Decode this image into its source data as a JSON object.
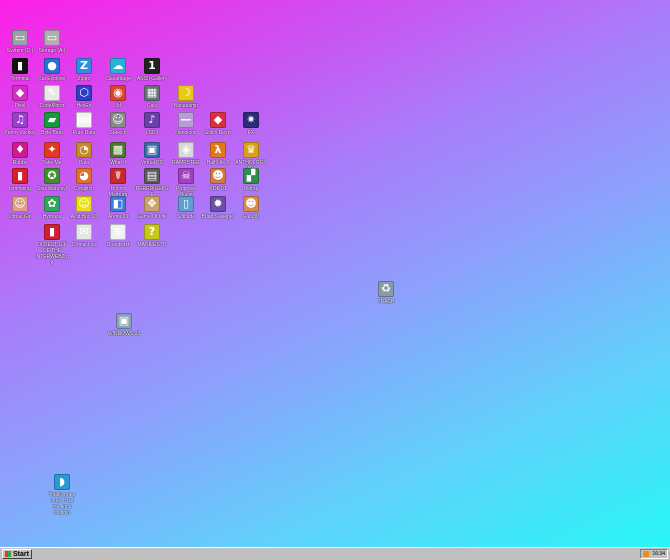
{
  "desktop": {
    "icons": [
      {
        "label": "System (C:)",
        "glyph": "▭",
        "color": "#9aa0a6",
        "name": "system-c-drive"
      },
      {
        "label": "Storage (A:)",
        "glyph": "▭",
        "color": "#b0b0b0",
        "name": "storage-a-drive"
      },
      {
        "label": "Terminal",
        "glyph": "▮",
        "color": "#111111",
        "name": "terminal"
      },
      {
        "label": "Cat Explorer",
        "glyph": "●",
        "color": "#2a6fd6",
        "name": "cat-explorer"
      },
      {
        "label": "Zippo",
        "glyph": "Z",
        "color": "#2f8de4",
        "name": "zippo"
      },
      {
        "label": "Clavardage",
        "glyph": "☁",
        "color": "#27b3d9",
        "name": "clavardage"
      },
      {
        "label": "ASCII Gallery",
        "glyph": "1",
        "color": "#222222",
        "name": "ascii-gallery"
      },
      {
        "label": "Pixel",
        "glyph": "◆",
        "color": "#d52cc4",
        "name": "pixel"
      },
      {
        "label": "CodeMirror",
        "glyph": "✎",
        "color": "#e8e8e8",
        "name": "codemirror"
      },
      {
        "label": "HexEd",
        "glyph": "⬡",
        "color": "#2e3cc9",
        "name": "hexed"
      },
      {
        "label": "3d",
        "glyph": "◉",
        "color": "#d9462f",
        "name": "3d"
      },
      {
        "label": "Calc",
        "glyph": "▦",
        "color": "#6a6f7a",
        "name": "calc"
      },
      {
        "label": "Bananamp",
        "glyph": "☽",
        "color": "#e8c91a",
        "name": "bananamp"
      },
      {
        "label": "Penny Jockey",
        "glyph": "♫",
        "color": "#9a3fcc",
        "name": "penny-jockey"
      },
      {
        "label": "Byte Beat",
        "glyph": "▰",
        "color": "#169a3a",
        "name": "byte-beat"
      },
      {
        "label": "Pure Data",
        "glyph": "pd",
        "color": "#f2f2f2",
        "name": "pure-data"
      },
      {
        "label": "Speech",
        "glyph": "☺",
        "color": "#8a8a8a",
        "name": "speech"
      },
      {
        "label": "LSDJ",
        "glyph": "♪",
        "color": "#6b3fa8",
        "name": "lsdj"
      },
      {
        "label": "Nanoloop",
        "glyph": "—",
        "color": "#b99bd8",
        "name": "nanoloop"
      },
      {
        "label": "Glitch Devts",
        "glyph": "◆",
        "color": "#d92f3f",
        "name": "glitch-devts"
      },
      {
        "label": "FX",
        "glyph": "✷",
        "color": "#2b2b7a",
        "name": "fx"
      },
      {
        "label": "Rubby",
        "glyph": "♦",
        "color": "#d01b8e",
        "name": "rubby"
      },
      {
        "label": "Take Me",
        "glyph": "✦",
        "color": "#e33a1f",
        "name": "take-me"
      },
      {
        "label": "Pata",
        "glyph": "◔",
        "color": "#c7882a",
        "name": "pata"
      },
      {
        "label": "What If",
        "glyph": "▩",
        "color": "#4b7a2a",
        "name": "what-if"
      },
      {
        "label": "Virtual PC",
        "glyph": "▣",
        "color": "#3b6ea8",
        "name": "virtual-pc"
      },
      {
        "label": "RAMPSTER",
        "glyph": "◈",
        "color": "#d9d9d9",
        "name": "rampster"
      },
      {
        "label": "Half-Life 3",
        "glyph": "λ",
        "color": "#e37a1a",
        "name": "half-life-3"
      },
      {
        "label": "ANTHOLOGY AVI",
        "glyph": "♛",
        "color": "#d6a21a",
        "name": "anthology-avi"
      },
      {
        "label": "lemmping",
        "glyph": "▮",
        "color": "#d81f2a",
        "name": "lemmping"
      },
      {
        "label": "Star Wars.avi",
        "glyph": "✪",
        "color": "#3f8f2f",
        "name": "star-wars-avi"
      },
      {
        "label": "Corglitch",
        "glyph": "◕",
        "color": "#e0702a",
        "name": "corglitch"
      },
      {
        "label": "Doctor Marburg",
        "glyph": "☤",
        "color": "#c82a2a",
        "name": "doctor-marburg"
      },
      {
        "label": "DEREDIGEKS E",
        "glyph": "▤",
        "color": "#5a5a5a",
        "name": "deredigekse"
      },
      {
        "label": "Progress Quest",
        "glyph": "☠",
        "color": "#a33fc2",
        "name": "progress-quest"
      },
      {
        "label": "KOF 91",
        "glyph": "☻",
        "color": "#d27a3f",
        "name": "kof-91"
      },
      {
        "label": "Defrag",
        "glyph": "▞",
        "color": "#2f8f4f",
        "name": "defrag"
      },
      {
        "label": "Virtual Girl",
        "glyph": "☺",
        "color": "#d9a08a",
        "name": "virtual-girl"
      },
      {
        "label": "Hydraze",
        "glyph": "✿",
        "color": "#2fa85a",
        "name": "hydraze"
      },
      {
        "label": "Acid Box 93",
        "glyph": "☺",
        "color": "#e8e01a",
        "name": "acid-box-93"
      },
      {
        "label": "Arena 93",
        "glyph": "◧",
        "color": "#3f7ad9",
        "name": "arena-93"
      },
      {
        "label": "Game Of Life",
        "glyph": "✥",
        "color": "#c9a36a",
        "name": "game-of-life"
      },
      {
        "label": "Solitude",
        "glyph": "▯",
        "color": "#5f9ed1",
        "name": "solitude"
      },
      {
        "label": "Brian Sweeper",
        "glyph": "✹",
        "color": "#6a4fa8",
        "name": "brian-sweeper"
      },
      {
        "label": "Gafa3D",
        "glyph": "☻",
        "color": "#d98a4f",
        "name": "gafa3d"
      },
      {
        "label": "OLDEST GIF OF THE INTERWEBZ.gif",
        "glyph": "▮",
        "color": "#d11f2f",
        "name": "oldest-gif"
      },
      {
        "label": "Contact us",
        "glyph": "✉",
        "color": "#e6e6e6",
        "name": "contact-us"
      },
      {
        "label": "Credits.txt",
        "glyph": "≡",
        "color": "#f0f0f0",
        "name": "credits-txt"
      },
      {
        "label": "MANIFESTO",
        "glyph": "?",
        "color": "#c8c81a",
        "name": "manifesto"
      }
    ],
    "trash": {
      "label": "TRASH",
      "glyph": "♻",
      "color": "#8a9aa8"
    },
    "windows93": {
      "label": "WINDOWS 93",
      "glyph": "▣",
      "color": "#8aa0b8"
    },
    "virus": {
      "label": "Totally not a virus.Trust me..im a dolphin",
      "glyph": "◗",
      "color": "#2a9ad0"
    }
  },
  "taskbar": {
    "start_label": "Start",
    "clock": "16:34"
  }
}
